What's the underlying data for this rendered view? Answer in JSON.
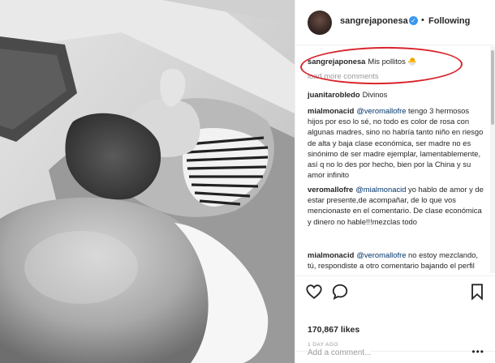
{
  "post": {
    "username": "sangrejaponesa",
    "separator": "•",
    "follow_label": "Following"
  },
  "caption": {
    "username": "sangrejaponesa",
    "text": "Mis pollitos 🐣"
  },
  "load_more": "load more comments",
  "comments": [
    {
      "username": "juanitarobledo",
      "mention": "",
      "text": "Divinos"
    },
    {
      "username": "mialmonacid",
      "mention": "@veromallofre",
      "text": "tengo 3 hermosos hijos por eso lo sé, no todo es color de rosa con algunas madres, sino no habría tanto niño en riesgo de alta y baja clase económica, ser madre no es sinónimo de ser madre ejemplar, lamentablemente, así q no lo des por hecho, bien por la China y su amor infinito"
    },
    {
      "username": "veromallofre",
      "mention": "@mialmonacid",
      "text": "yo hablo de amor y de estar presente,de acompañar, de lo que vos mencionaste en el comentario. De clase económica y dinero no hable!!!mezclas todo"
    },
    {
      "username": "mialmonacid",
      "mention": "@veromallofre",
      "text": "no estoy mezclando, tú, respondiste a otro comentario bajando el perfil de buena"
    }
  ],
  "likes": "170,867 likes",
  "time_ago": "1 DAY AGO",
  "add_comment_placeholder": "Add a comment...",
  "more_options": "•••",
  "icons": [
    "heart-icon",
    "comment-icon",
    "bookmark-icon",
    "verified-badge-icon",
    "more-options-icon"
  ],
  "colors": {
    "accent": "#3897f0",
    "highlight_oval": "#d9242c",
    "mention": "#003569"
  }
}
